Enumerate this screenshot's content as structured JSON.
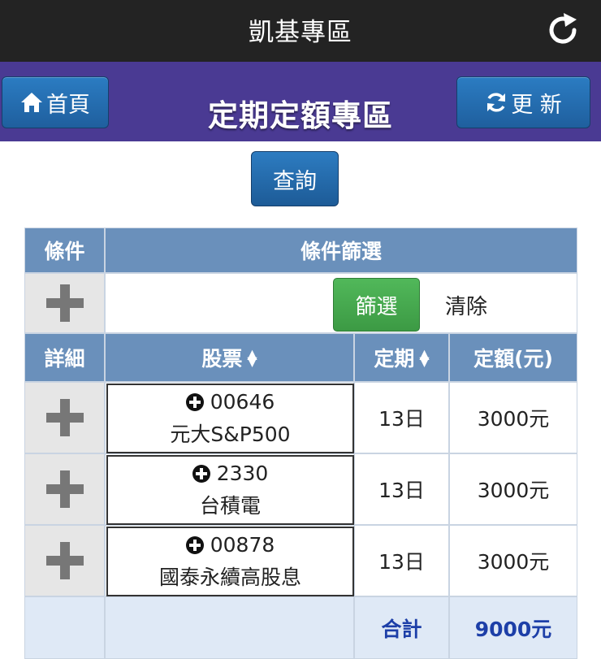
{
  "topbar": {
    "title": "凱基專區",
    "reload_icon": "reload-icon"
  },
  "header": {
    "title": "定期定額專區",
    "home_label": "首頁",
    "refresh_label": "更 新"
  },
  "query_button": "查詢",
  "filter_section": {
    "col_condition": "條件",
    "col_filter": "條件篩選",
    "filter_button": "篩選",
    "clear_button": "清除"
  },
  "table": {
    "headers": {
      "detail": "詳細",
      "stock": "股票",
      "period": "定期",
      "amount": "定額(元)"
    },
    "rows": [
      {
        "code": "00646",
        "name": "元大S&P500",
        "period": "13日",
        "amount": "3000元"
      },
      {
        "code": "2330",
        "name": "台積電",
        "period": "13日",
        "amount": "3000元"
      },
      {
        "code": "00878",
        "name": "國泰永續高股息",
        "period": "13日",
        "amount": "3000元"
      }
    ],
    "total_label": "合計",
    "total_value": "9000元"
  },
  "colors": {
    "topbar": "#232323",
    "header": "#4a3a93",
    "table_header": "#6a90bb",
    "total_text": "#1d3fa8",
    "filter_button": "#4caf50"
  }
}
